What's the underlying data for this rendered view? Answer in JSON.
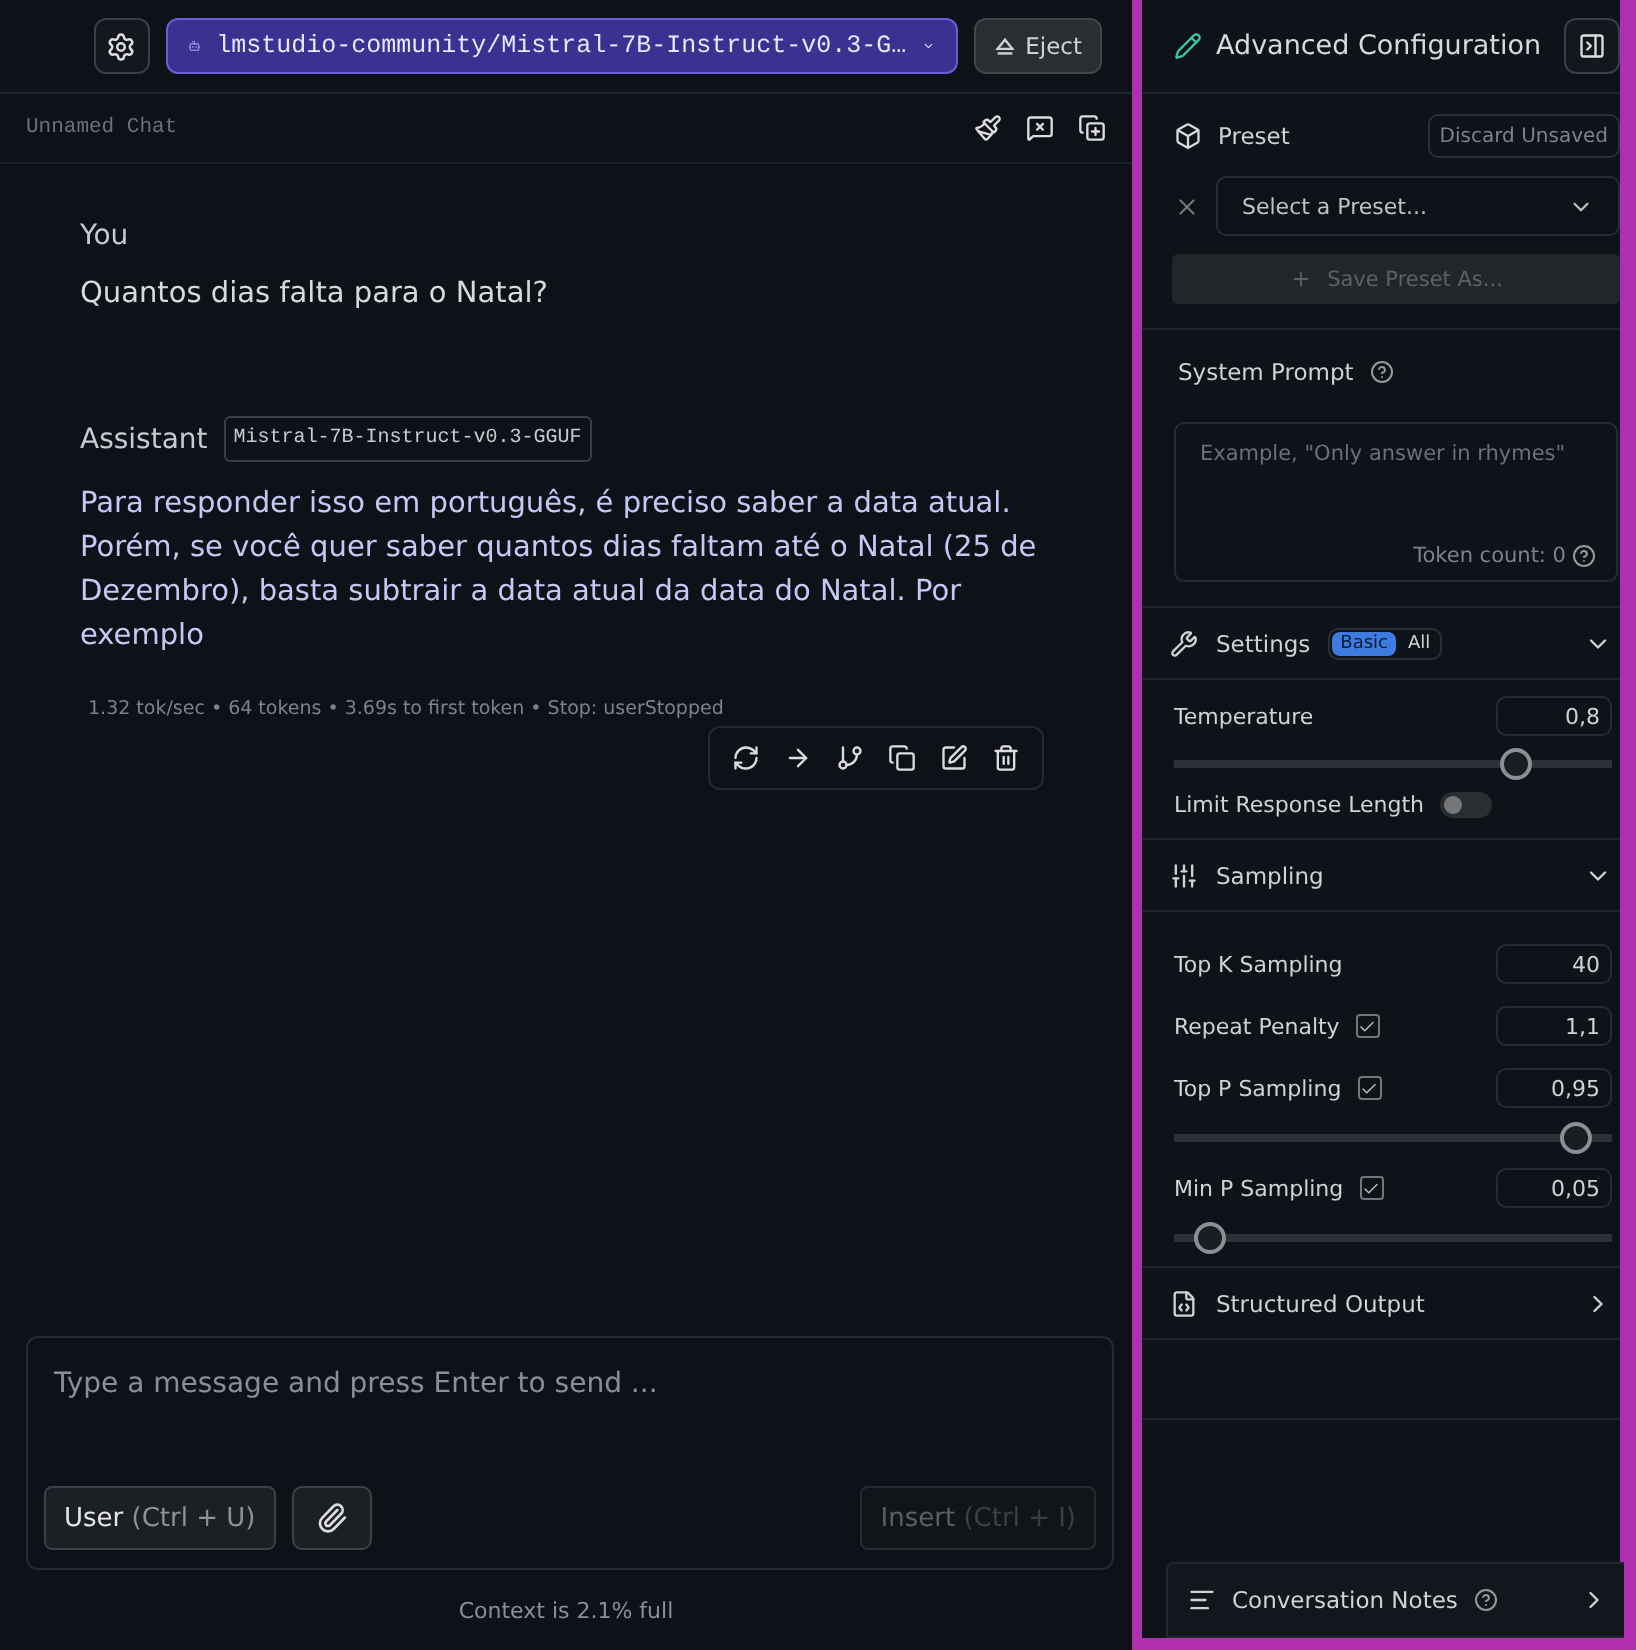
{
  "top_bar": {
    "model": "lmstudio-community/Mistral-7B-Instruct-v0.3-G…",
    "eject": "Eject"
  },
  "chat": {
    "title": "Unnamed Chat",
    "messages": [
      {
        "role": "You",
        "text": "Quantos dias falta para o Natal?"
      },
      {
        "role": "Assistant",
        "model_tag": "Mistral-7B-Instruct-v0.3-GGUF",
        "text": "Para responder isso em português, é preciso saber a data atual. Porém, se você quer saber quantos dias faltam até o Natal (25 de Dezembro), basta subtrair a data atual da data do Natal. Por exemplo",
        "stats": "1.32 tok/sec • 64 tokens • 3.69s to first token • Stop: userStopped"
      }
    ]
  },
  "composer": {
    "placeholder": "Type a message and press Enter to send ...",
    "role_button": "User",
    "role_shortcut": "(Ctrl + U)",
    "insert_button": "Insert",
    "insert_shortcut": "(Ctrl + I)",
    "insert_disabled": true,
    "context": "Context is 2.1% full"
  },
  "panel": {
    "title": "Advanced Configuration",
    "preset": {
      "label": "Preset",
      "discard": "Discard Unsaved",
      "select_placeholder": "Select a Preset...",
      "save": "Save Preset As..."
    },
    "system_prompt": {
      "label": "System Prompt",
      "placeholder": "Example, \"Only answer in rhymes\"",
      "token_count": "Token count: 0"
    },
    "settings": {
      "label": "Settings",
      "expanded": true,
      "tabs": [
        {
          "label": "Basic",
          "selected": true
        },
        {
          "label": "All",
          "selected": false
        }
      ],
      "rows": [
        {
          "kind": "slider",
          "label": "Temperature",
          "value": "0,8",
          "level": 0.78
        },
        {
          "kind": "toggle",
          "label": "Limit Response Length",
          "on": false
        }
      ]
    },
    "sampling": {
      "label": "Sampling",
      "expanded": true,
      "rows": [
        {
          "kind": "number",
          "label": "Top K Sampling",
          "value": "40"
        },
        {
          "kind": "check",
          "label": "Repeat Penalty",
          "checked": true,
          "value": "1,1"
        },
        {
          "kind": "checkslider",
          "label": "Top P Sampling",
          "checked": true,
          "value": "0,95",
          "level": 0.92
        },
        {
          "kind": "checkslider",
          "label": "Min P Sampling",
          "checked": true,
          "value": "0,05",
          "level": 0.08
        }
      ]
    },
    "structured_output": {
      "label": "Structured Output",
      "expanded": false
    },
    "notes": {
      "label": "Conversation Notes",
      "expanded": false
    }
  }
}
